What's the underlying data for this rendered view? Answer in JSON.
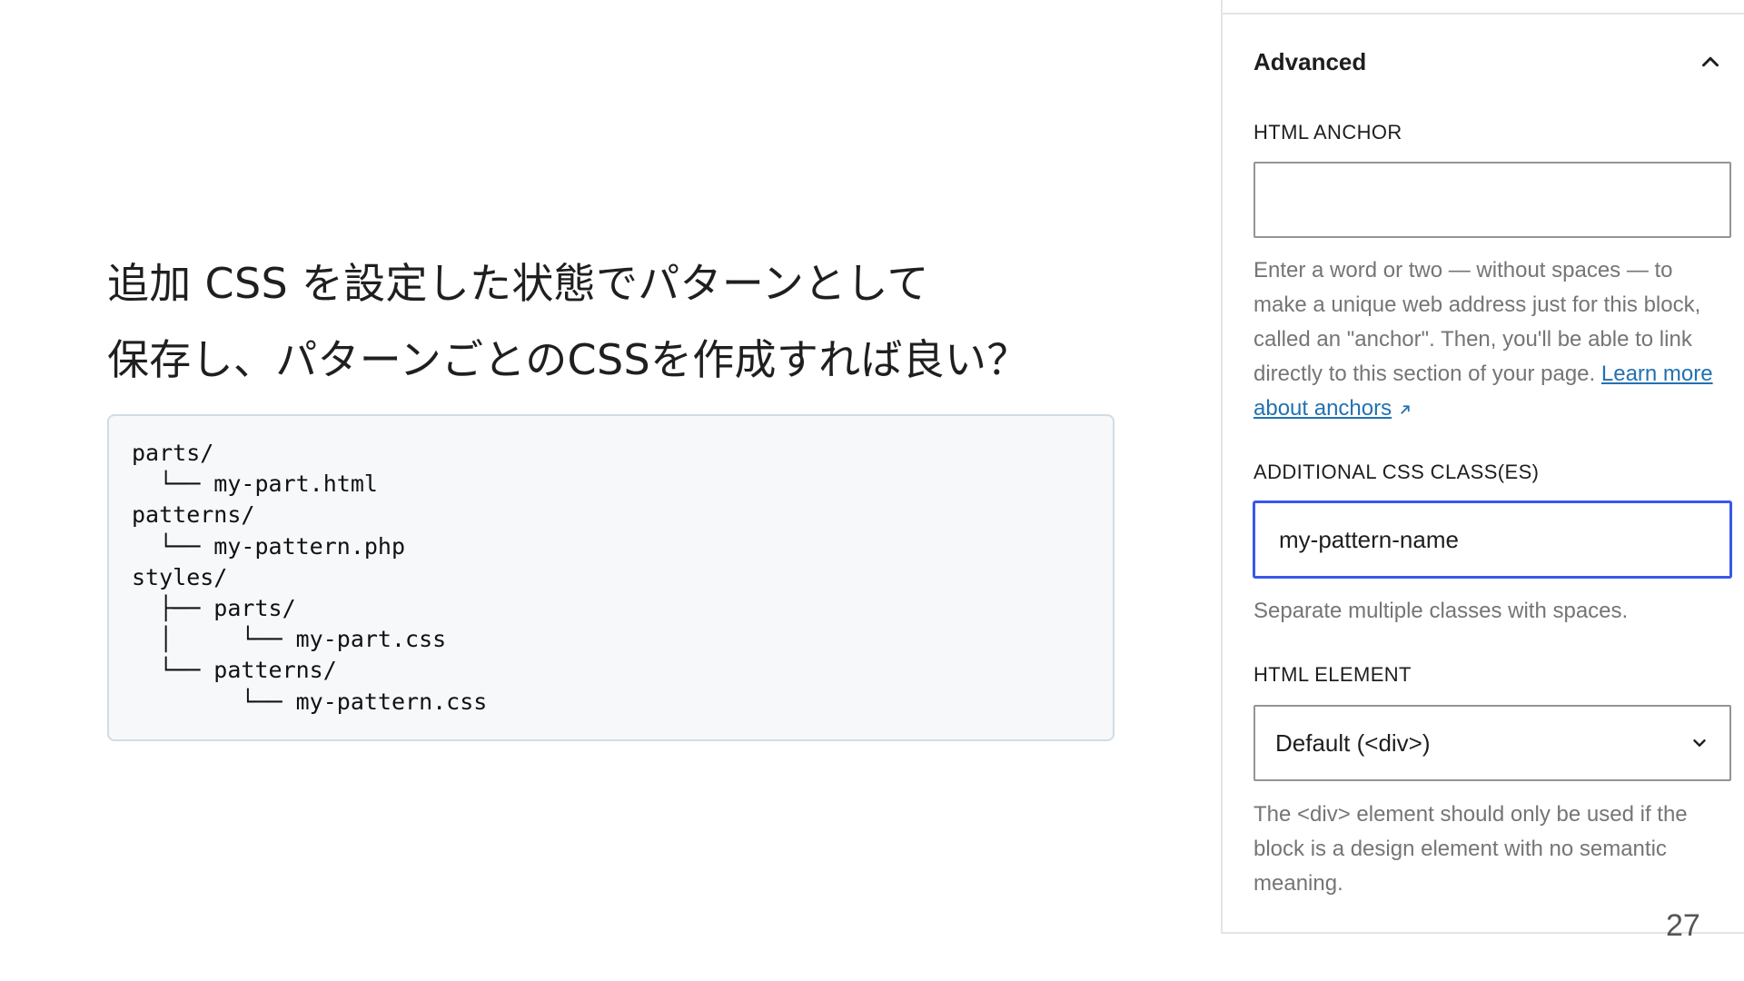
{
  "slide": {
    "heading_line1": "追加 CSS を設定した状態でパターンとして",
    "heading_line2": "保存し、パターンごとのCSSを作成すれば良い？",
    "code": "parts/\n  └── my-part.html\npatterns/\n  └── my-pattern.php\nstyles/\n  ├── parts/\n  │     └── my-part.css\n  └── patterns/\n        └── my-pattern.css",
    "page_number": "27"
  },
  "sidebar": {
    "panel_title": "Advanced",
    "html_anchor": {
      "label": "HTML ANCHOR",
      "value": "",
      "help_text": "Enter a word or two — without spaces — to make a unique web address just for this block, called an \"anchor\". Then, you'll be able to link directly to this section of your page.",
      "link_text": "Learn more about anchors"
    },
    "css_classes": {
      "label": "ADDITIONAL CSS CLASS(ES)",
      "value": "my-pattern-name",
      "help_text": "Separate multiple classes with spaces."
    },
    "html_element": {
      "label": "HTML ELEMENT",
      "selected": "Default (<div>)",
      "help_text": "The <div> element should only be used if the block is a design element with no semantic meaning."
    }
  },
  "colors": {
    "focus_blue": "#3858e9",
    "link_blue": "#2271b1",
    "help_gray": "#757575",
    "code_bg": "#f6f8fa"
  }
}
